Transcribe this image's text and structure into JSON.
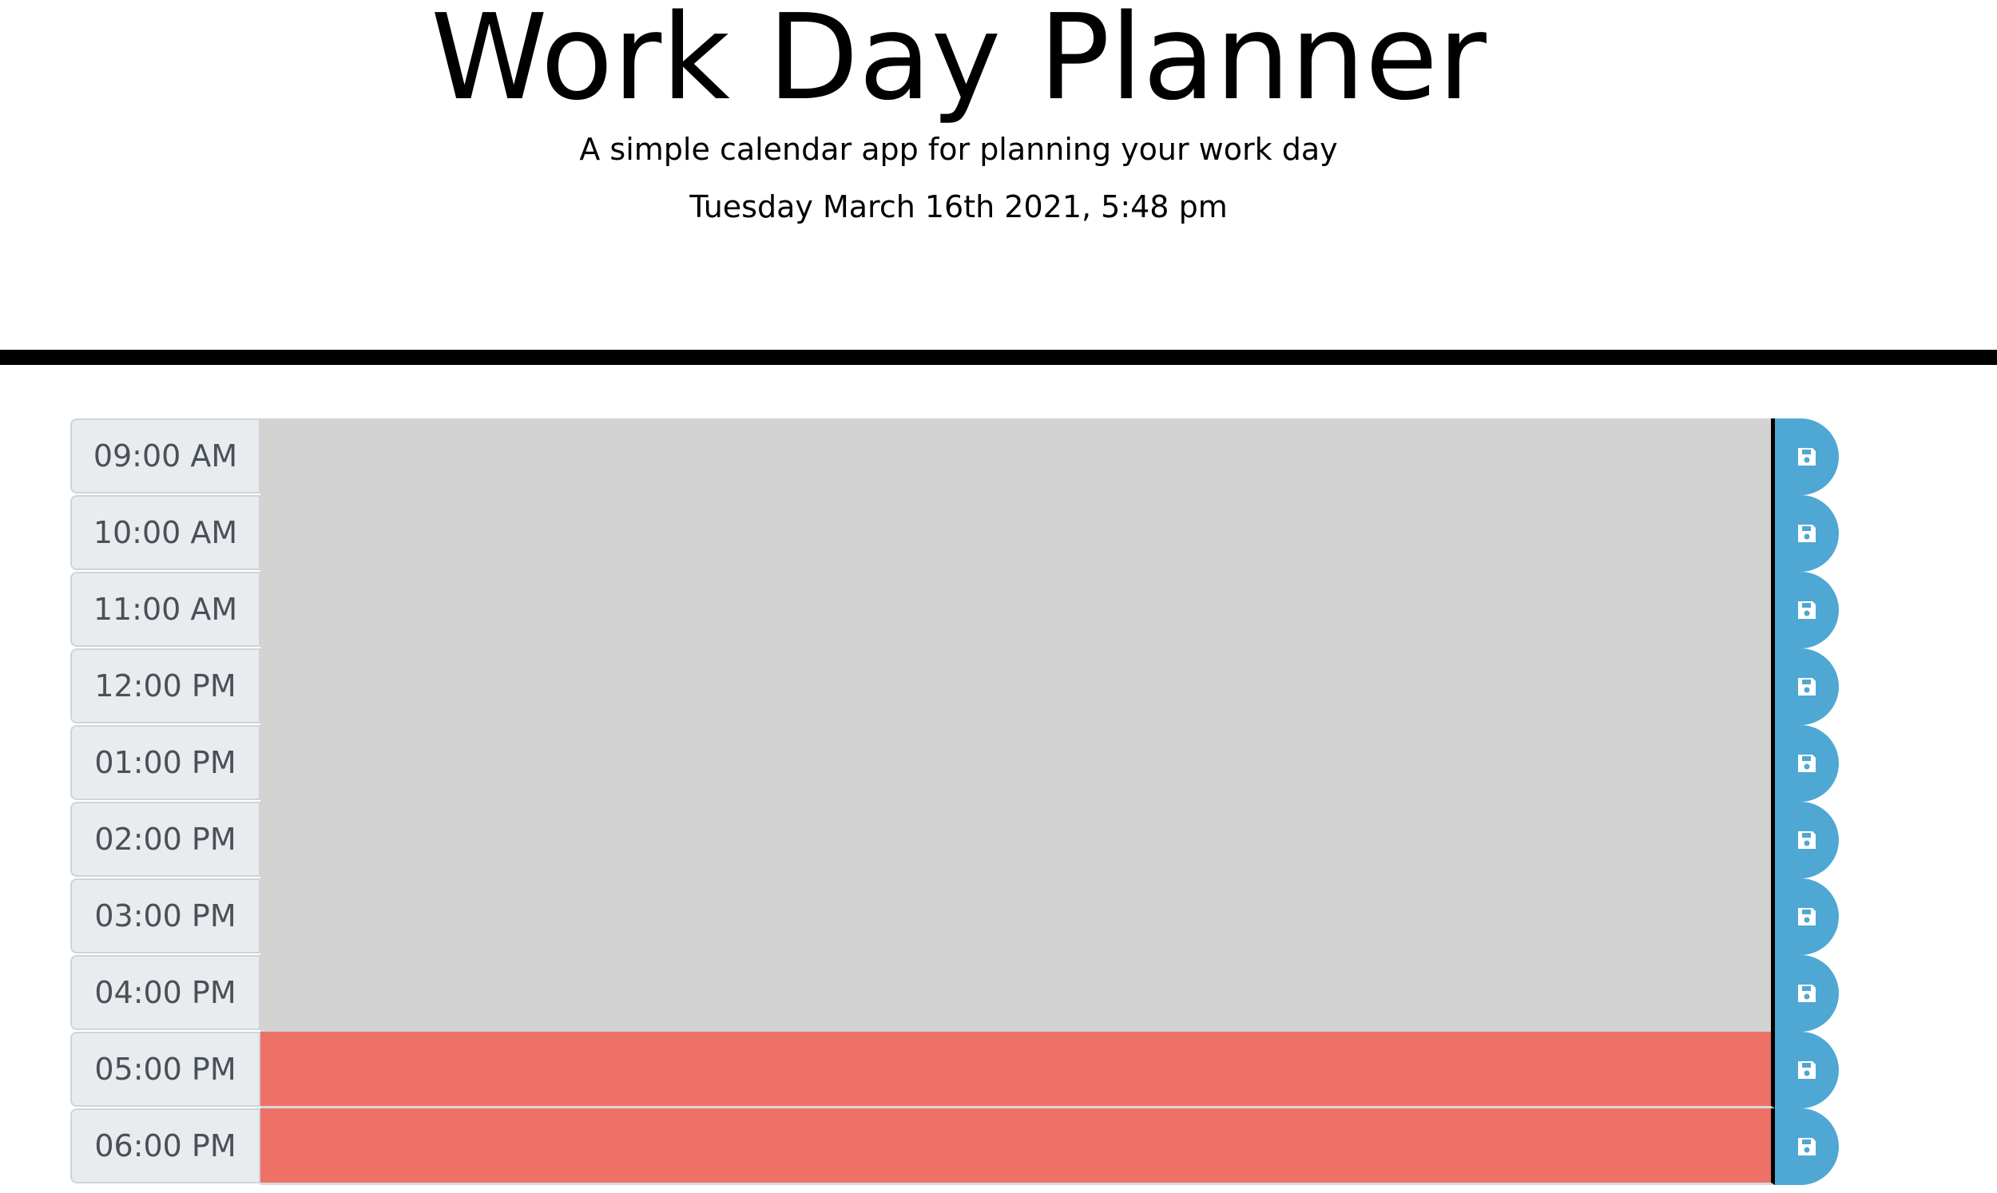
{
  "header": {
    "title": "Work Day Planner",
    "subtitle": "A simple calendar app for planning your work day",
    "current_datetime": "Tuesday March 16th 2021, 5:48 pm"
  },
  "colors": {
    "past": "#d3d3d4",
    "present": "#ee7168",
    "save_button": "#4fa7d3"
  },
  "time_blocks": [
    {
      "hour": "09:00 AM",
      "text": "",
      "state": "past"
    },
    {
      "hour": "10:00 AM",
      "text": "",
      "state": "past"
    },
    {
      "hour": "11:00 AM",
      "text": "",
      "state": "past"
    },
    {
      "hour": "12:00 PM",
      "text": "",
      "state": "past"
    },
    {
      "hour": "01:00 PM",
      "text": "",
      "state": "past"
    },
    {
      "hour": "02:00 PM",
      "text": "",
      "state": "past"
    },
    {
      "hour": "03:00 PM",
      "text": "",
      "state": "past"
    },
    {
      "hour": "04:00 PM",
      "text": "",
      "state": "past"
    },
    {
      "hour": "05:00 PM",
      "text": "",
      "state": "present"
    },
    {
      "hour": "06:00 PM",
      "text": "",
      "state": "present"
    }
  ],
  "save_icon": "floppy-disk-icon"
}
